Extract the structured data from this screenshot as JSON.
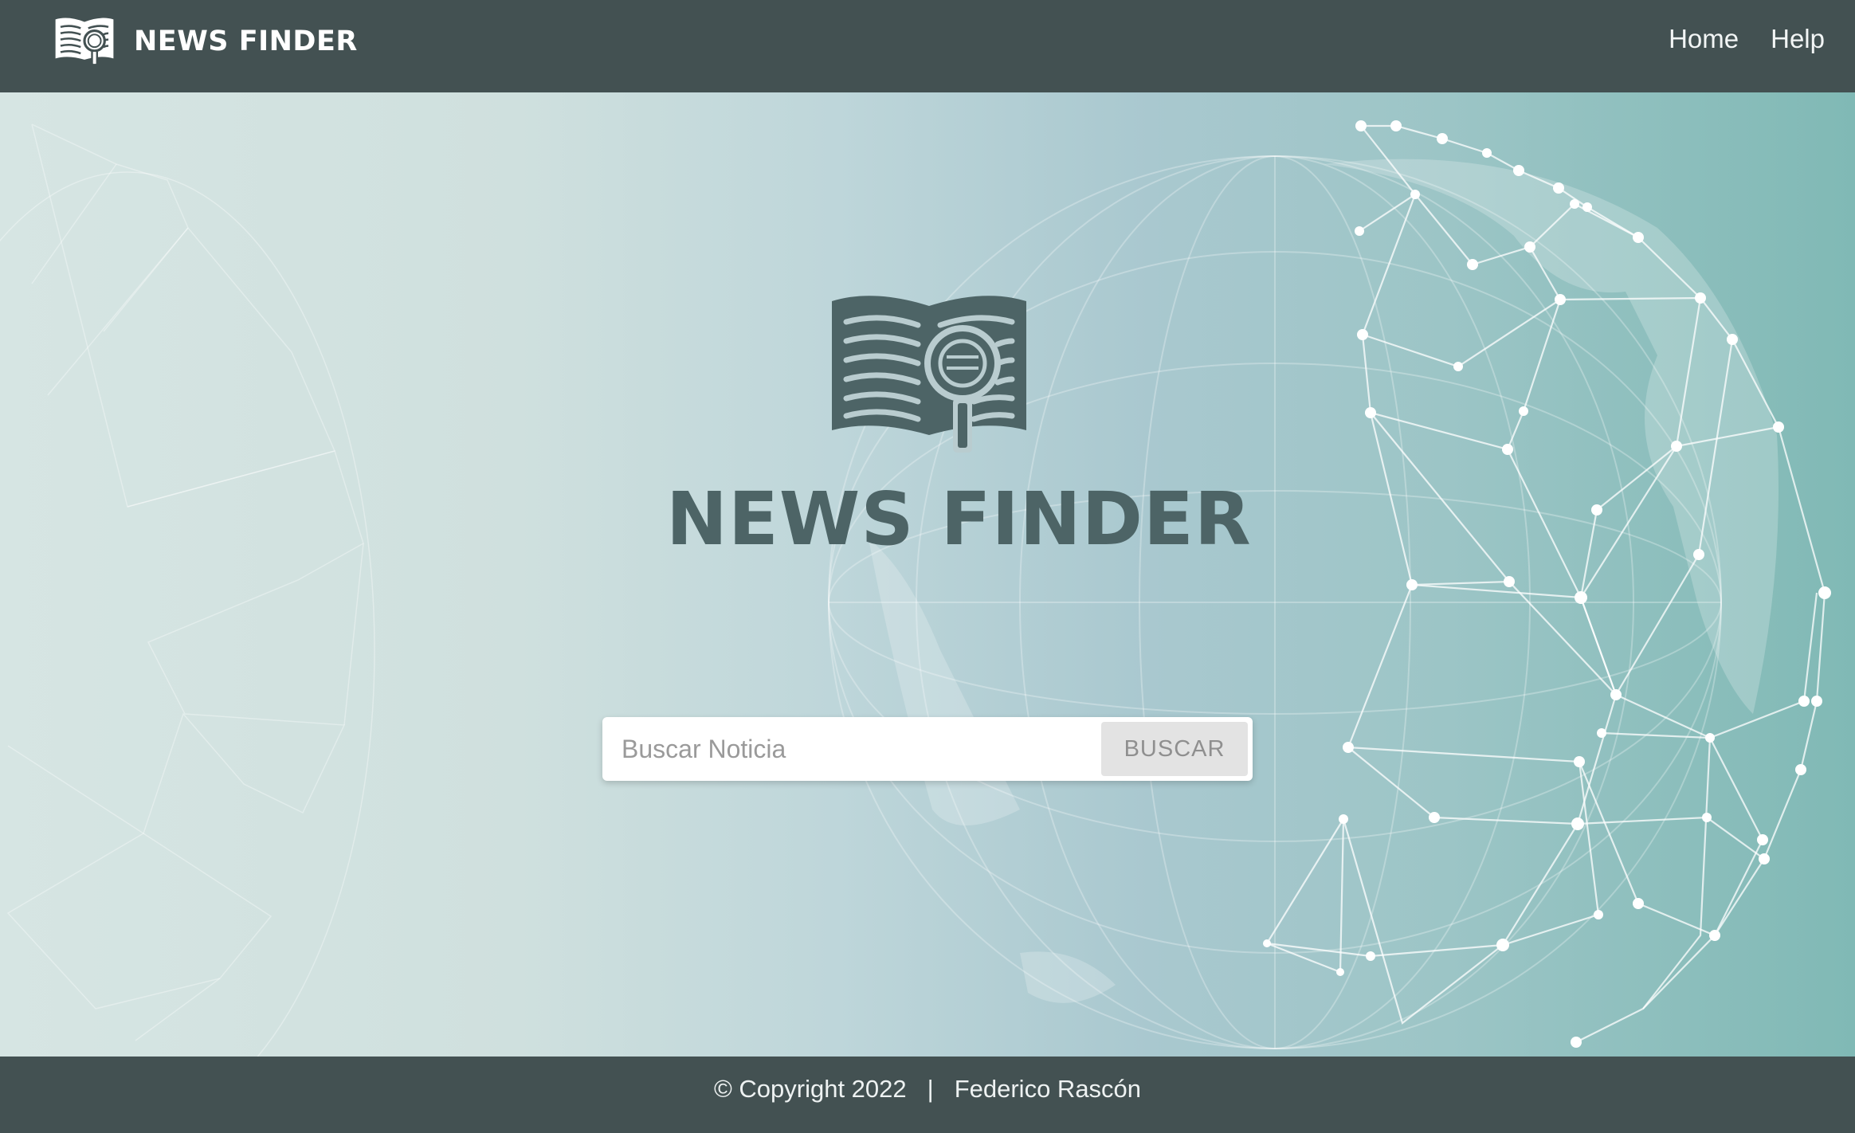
{
  "navbar": {
    "brand": "NEWS FINDER",
    "links": [
      "Home",
      "Help"
    ]
  },
  "hero": {
    "title": "NEWS FINDER",
    "search": {
      "placeholder": "Buscar Noticia",
      "button_label": "BUSCAR"
    }
  },
  "footer": {
    "copyright": "© Copyright 2022",
    "separator": "|",
    "author": "Federico Rascón"
  },
  "colors": {
    "header_bg": "#435152",
    "logo": "#4d6466",
    "button_bg": "#e3e3e3"
  },
  "icons": [
    "open-book-magnifier-icon"
  ]
}
